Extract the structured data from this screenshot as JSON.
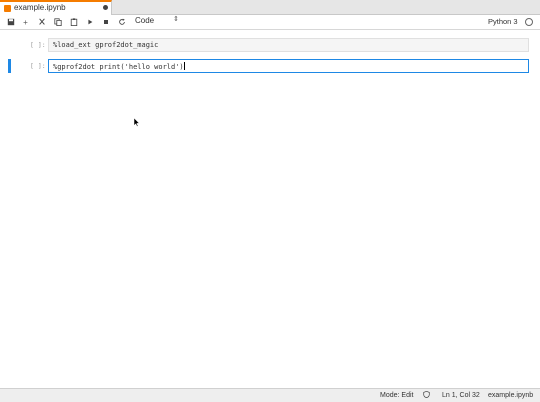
{
  "tabbar": {
    "active_tab": {
      "label": "example.ipynb",
      "dirty": true,
      "accent_color": "#f57c00"
    }
  },
  "toolbar": {
    "buttons": [
      {
        "name": "save",
        "icon": "save-icon"
      },
      {
        "name": "insert",
        "icon": "plus-icon",
        "glyph": "+"
      },
      {
        "name": "cut",
        "icon": "scissors-icon"
      },
      {
        "name": "copy",
        "icon": "copy-icon"
      },
      {
        "name": "paste",
        "icon": "paste-icon"
      },
      {
        "name": "run",
        "icon": "play-icon"
      },
      {
        "name": "interrupt",
        "icon": "stop-icon"
      },
      {
        "name": "restart",
        "icon": "restart-icon"
      }
    ],
    "cell_type": "Code",
    "kernel_name": "Python 3"
  },
  "cells": [
    {
      "prompt": "[ ]:",
      "code": "%load_ext gprof2dot_magic",
      "active": false
    },
    {
      "prompt": "[ ]:",
      "code": "%gprof2dot print('hello world')",
      "active": true
    }
  ],
  "statusbar": {
    "mode": "Mode: Edit",
    "position": "Ln 1, Col 32",
    "filename": "example.ipynb"
  },
  "colors": {
    "active_cell_border": "#1e88e5",
    "tab_accent": "#f57c00"
  }
}
